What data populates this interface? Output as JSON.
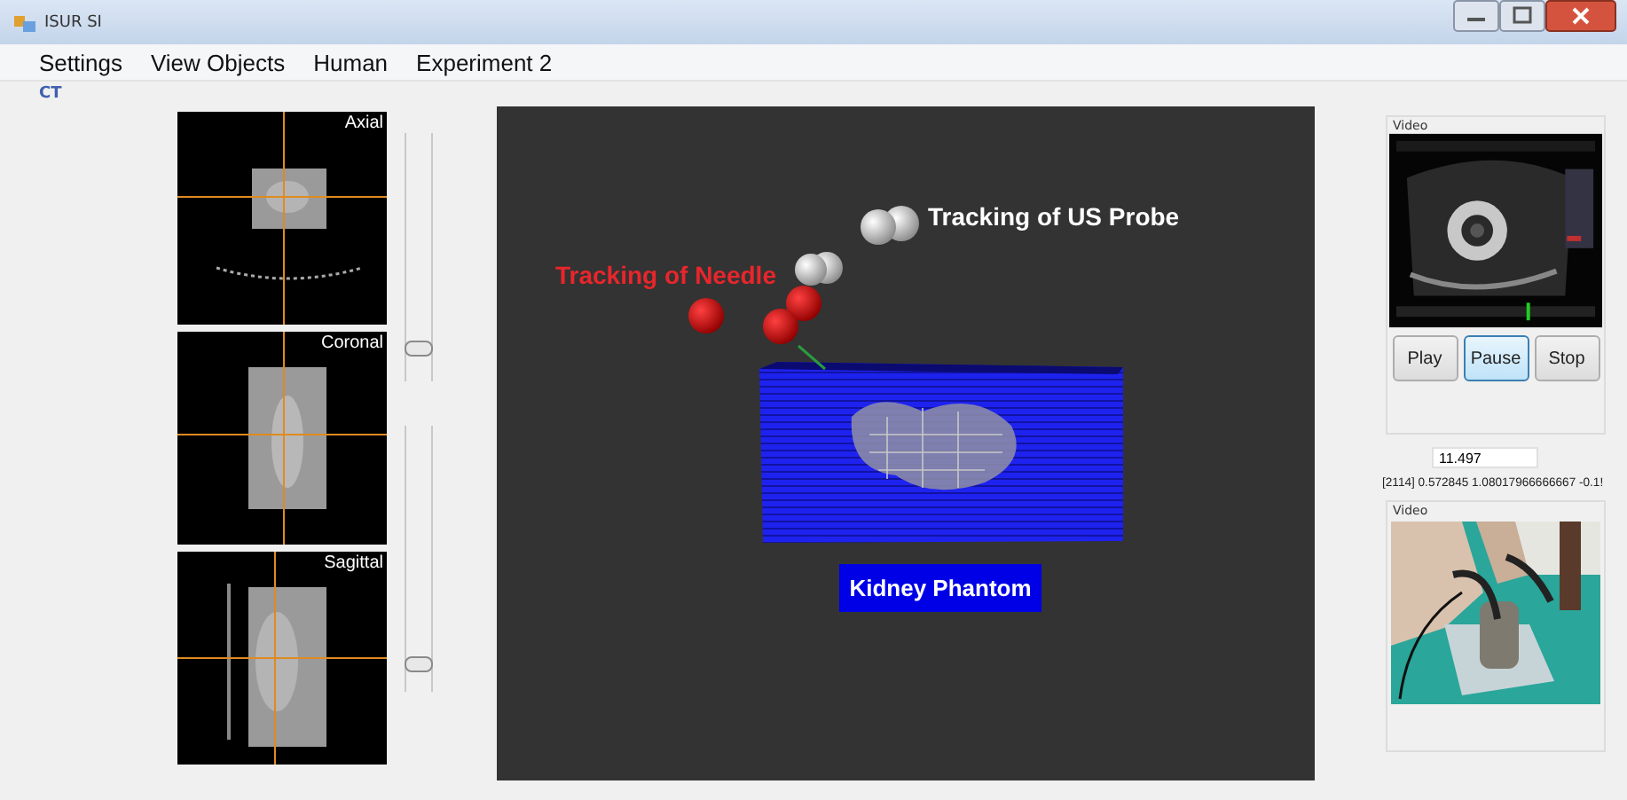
{
  "window": {
    "title": "ISUR SI"
  },
  "menu": [
    {
      "label": "Settings"
    },
    {
      "label": "View Objects"
    },
    {
      "label": "Human"
    },
    {
      "label": "Experiment 2"
    }
  ],
  "tab": {
    "label": "CT"
  },
  "ct_views": [
    {
      "label": "Axial",
      "kind": "picture"
    },
    {
      "label": "Coronal",
      "kind": "picture"
    },
    {
      "label": "Sagittal",
      "kind": "picture"
    }
  ],
  "sliders": [
    {
      "level": 0.13
    },
    {
      "level": 0.1
    }
  ],
  "scene": {
    "labels": [
      {
        "text": "Tracking of US Probe",
        "color": "#ffffff"
      },
      {
        "text": "Tracking of Needle",
        "color": "#e8262b"
      }
    ],
    "phantom_label": "Kidney Phantom"
  },
  "video_panels": [
    {
      "title": "Video",
      "kind": "picture"
    },
    {
      "title": "Video",
      "kind": "picture"
    }
  ],
  "buttons": [
    {
      "label": "Play",
      "selected": false
    },
    {
      "label": "Pause",
      "selected": true
    },
    {
      "label": "Stop",
      "selected": false
    }
  ],
  "time_field": {
    "value": "11.497"
  },
  "readout": "[2114]  0.572845 1.08017966666667 -0.1!"
}
